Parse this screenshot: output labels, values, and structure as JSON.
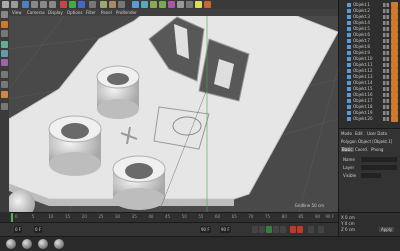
{
  "toolbar": {
    "icons": [
      "undo-icon",
      "redo-icon",
      "select-icon",
      "move-icon",
      "scale-icon",
      "rotate-icon",
      "x-axis-icon",
      "y-axis-icon",
      "z-axis-icon",
      "world-icon",
      "render-view-icon",
      "render-icon",
      "render-settings-icon",
      "cube-icon",
      "pen-icon",
      "subdivision-icon",
      "array-icon",
      "deformer-icon",
      "floor-icon",
      "camera-icon",
      "light-icon",
      "python-icon"
    ]
  },
  "viewport": {
    "menu": [
      "View",
      "Cameras",
      "Display",
      "Options",
      "Filter",
      "Panel",
      "ProRender"
    ],
    "label": "Gridline 50 cm"
  },
  "object_manager": {
    "items": [
      "Objekt.1",
      "Objekt.2",
      "Objekt.3",
      "Objekt.4",
      "Objekt.5",
      "Objekt.6",
      "Objekt.7",
      "Objekt.8",
      "Objekt.9",
      "Objekt.10",
      "Objekt.11",
      "Objekt.12",
      "Objekt.13",
      "Objekt.14",
      "Objekt.15",
      "Objekt.16",
      "Objekt.17",
      "Objekt.18",
      "Objekt.19",
      "Objekt.20"
    ]
  },
  "attributes": {
    "tabs": [
      "Mode",
      "Edit",
      "User Data"
    ],
    "title": "Polygon Object [Objekt.1]",
    "tab2": [
      "Basic",
      "Coord.",
      "Phong"
    ],
    "fields": [
      "Name",
      "Layer",
      "Visible"
    ]
  },
  "timeline": {
    "ticks": [
      "0",
      "5",
      "10",
      "15",
      "20",
      "25",
      "30",
      "35",
      "40",
      "45",
      "50",
      "55",
      "60",
      "65",
      "70",
      "75",
      "80",
      "85",
      "90"
    ],
    "end_frame": "90 F"
  },
  "playbar": {
    "start": "0 F",
    "current": "0 F",
    "end": "90 F",
    "end2": "90 F"
  },
  "coords": {
    "x": "X 0 cm",
    "y": "Y 0 cm",
    "z": "Z 0 cm",
    "apply": "Apply"
  },
  "colors": {
    "accent": "#cf7a2a",
    "object_icon": "#5a9ad8",
    "record": "#c0392b",
    "model": "#e6e6e6"
  }
}
